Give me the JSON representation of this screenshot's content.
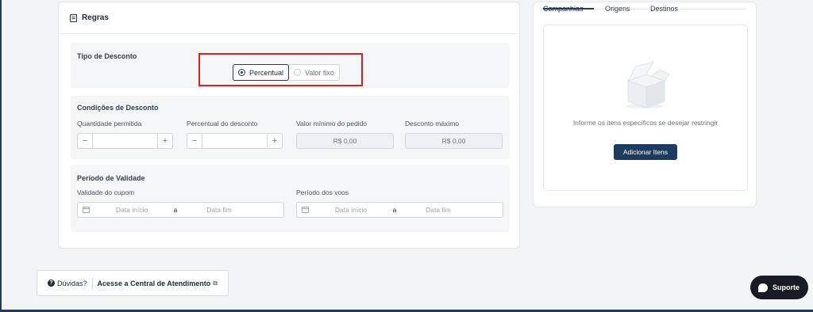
{
  "rules": {
    "title": "Regras",
    "discount_type": {
      "label": "Tipo de Desconto",
      "options": [
        "Percentual",
        "Valor fixo"
      ],
      "selected": "Percentual"
    },
    "conditions": {
      "title": "Condições de Desconto",
      "quantity_label": "Quantidade permitida",
      "percent_label": "Percentual do desconto",
      "min_order_label": "Valor mínimo do pedido",
      "min_order_value": "R$ 0,00",
      "max_discount_label": "Desconto máximo",
      "max_discount_value": "R$ 0,00",
      "minus": "−",
      "plus": "+"
    },
    "validity": {
      "title": "Período de Validade",
      "coupon_label": "Validade do cupom",
      "flights_label": "Período dos voos",
      "start_placeholder": "Data início",
      "separator": "a",
      "end_placeholder": "Data fim"
    }
  },
  "side_panel": {
    "tabs": [
      "Companhias",
      "Origens",
      "Destinos"
    ],
    "active_tab": "Companhias",
    "empty_message": "Informe os itens específicos se desejar restringir",
    "add_button": "Adicionar Itens"
  },
  "help": {
    "question": "Dúvidas?",
    "link": "Acesse a Central de Atendimento"
  },
  "support": {
    "label": "Suporte"
  },
  "icons": {
    "rules": "clipboard-icon",
    "help": "question-circle-icon",
    "external": "external-link-icon",
    "calendar": "calendar-icon",
    "empty": "empty-box-icon",
    "chat": "chat-icon"
  },
  "colors": {
    "primary": "#1e3a5f",
    "highlight": "#e02020",
    "support_bg": "#161b26"
  }
}
